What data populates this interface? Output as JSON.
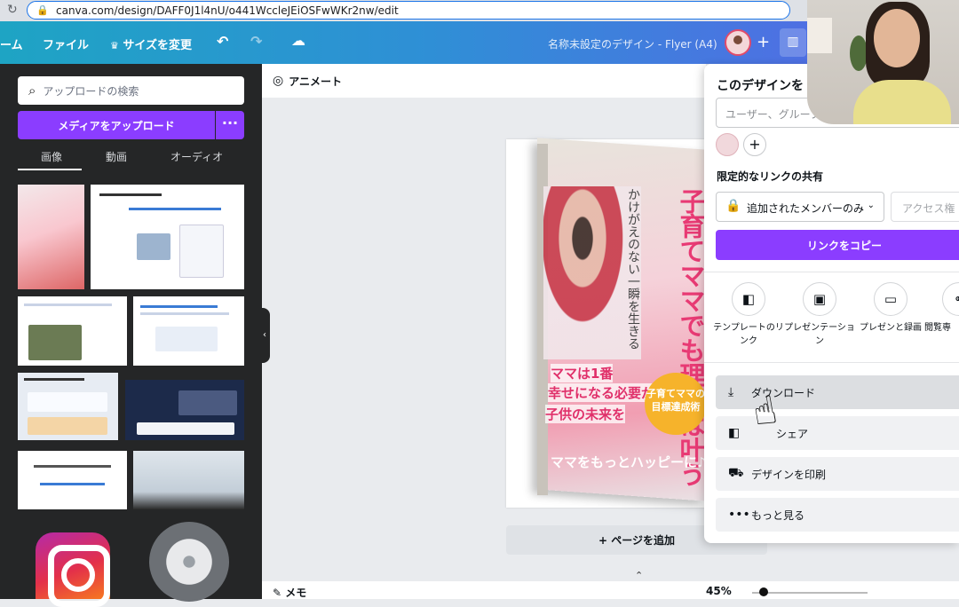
{
  "browser": {
    "url": "canva.com/design/DAFF0J1l4nU/o441WccleJEiOSFwWKr2nw/edit"
  },
  "topbar": {
    "home": "ーム",
    "file": "ファイル",
    "resize": "サイズを変更",
    "design_title": "名称未設定のデザイン - Flyer (A4)"
  },
  "sidebar": {
    "search_placeholder": "アップロードの検索",
    "upload_label": "メディアをアップロード",
    "tabs": [
      "画像",
      "動画",
      "オーディオ"
    ]
  },
  "canvas": {
    "animate_label": "アニメート",
    "add_page_label": "+ ページを追加",
    "memo_label": "メモ",
    "zoom": "45%",
    "book": {
      "title": "子育てママでも理想は叶う",
      "subtitle": "かけがえのない一瞬を生きる",
      "line1": "ママは1番",
      "line2": "幸せになる必要がある",
      "line3": "子供の未来を",
      "line4": "ママをもっとハッピーに♪",
      "badge": "子育てママの目標達成術"
    }
  },
  "share_panel": {
    "title": "このデザインを",
    "invite_placeholder": "ユーザー、グループ、",
    "link_section": "限定的なリンクの共有",
    "link_select": "追加されたメンバーのみ",
    "access_select": "アクセス権",
    "copy_label": "リンクをコピー",
    "options": [
      {
        "label": "テンプレートのリンク"
      },
      {
        "label": "プレゼンテーション"
      },
      {
        "label": "プレゼンと録画"
      },
      {
        "label": "閲覧専"
      }
    ],
    "actions": {
      "download": "ダウンロード",
      "share_ext": "シェア",
      "print": "デザインを印刷",
      "more": "もっと見る"
    }
  },
  "colors": {
    "brand_purple": "#8b3dff",
    "topbar_start": "#1ea4c4",
    "topbar_end": "#5b63e8",
    "sidebar_bg": "#252627"
  }
}
